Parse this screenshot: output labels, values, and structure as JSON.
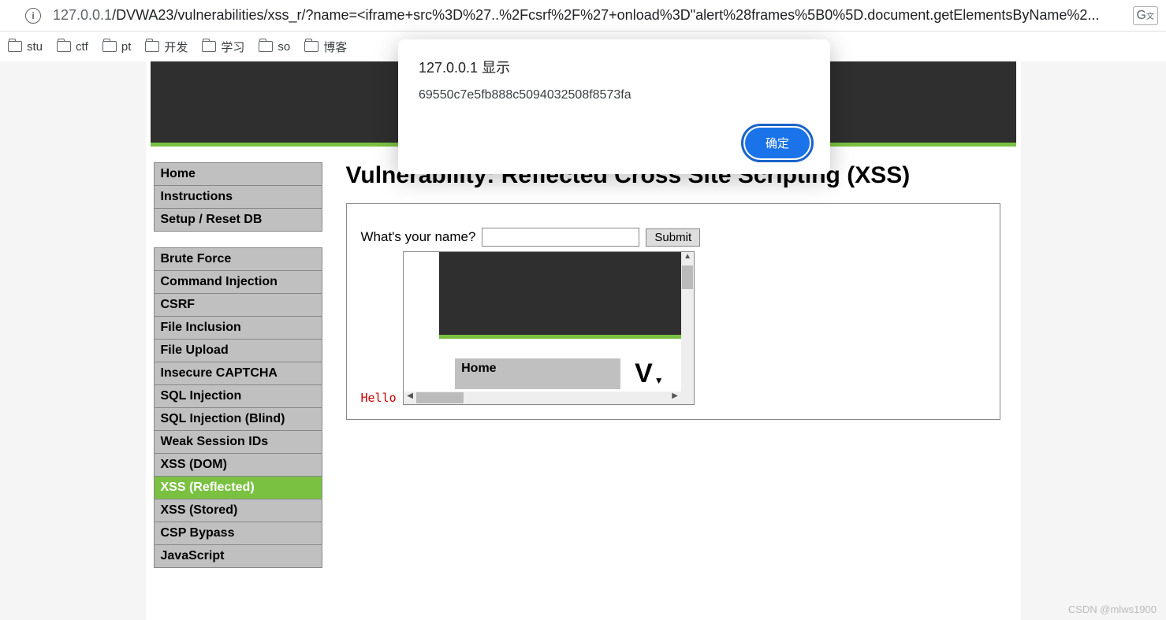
{
  "url_faded_prefix": "127.0.0.1",
  "url_path": "/DVWA23/vulnerabilities/xss_r/?name=<iframe+src%3D%27..%2Fcsrf%2F%27+onload%3D\"alert%28frames%5B0%5D.document.getElementsByName%2...",
  "bookmarks": [
    "stu",
    "ctf",
    "pt",
    "开发",
    "学习",
    "so",
    "博客"
  ],
  "alert": {
    "title": "127.0.0.1 显示",
    "message": "69550c7e5fb888c5094032508f8573fa",
    "ok": "确定"
  },
  "page": {
    "title": "Vulnerability: Reflected Cross Site Scripting (XSS)",
    "form_label": "What's your name?",
    "submit": "Submit",
    "hello": "Hello",
    "inner_home": "Home",
    "big_v": "V"
  },
  "menu": {
    "g1": [
      "Home",
      "Instructions",
      "Setup / Reset DB"
    ],
    "g2": [
      "Brute Force",
      "Command Injection",
      "CSRF",
      "File Inclusion",
      "File Upload",
      "Insecure CAPTCHA",
      "SQL Injection",
      "SQL Injection (Blind)",
      "Weak Session IDs",
      "XSS (DOM)",
      "XSS (Reflected)",
      "XSS (Stored)",
      "CSP Bypass",
      "JavaScript"
    ]
  },
  "active_item": "XSS (Reflected)",
  "watermark": "CSDN @mlws1900"
}
